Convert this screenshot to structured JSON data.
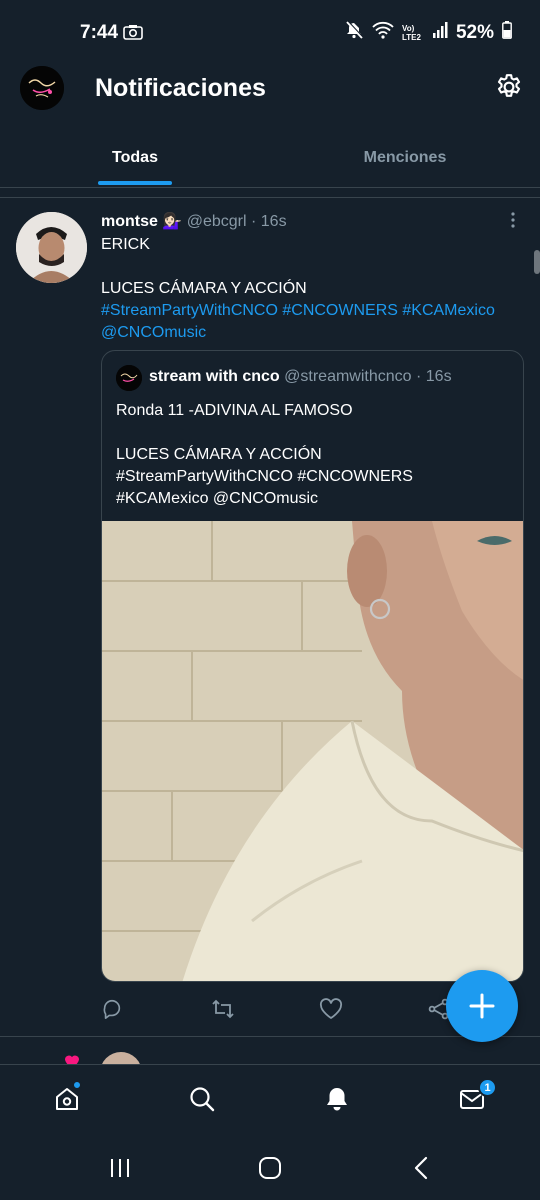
{
  "status_bar": {
    "time": "7:44",
    "network_label": "Vo) LTE2",
    "battery": "52%"
  },
  "header": {
    "title": "Notificaciones",
    "avatar_label": "Stream Party CNCO"
  },
  "tabs": [
    {
      "label": "Todas",
      "active": true
    },
    {
      "label": "Menciones",
      "active": false
    }
  ],
  "tweet": {
    "name": "montse 💁🏻‍♀️",
    "handle": "@ebcgrl",
    "separator": "·",
    "time": "16s",
    "text_lines": [
      {
        "text": "ERICK",
        "color": "white"
      },
      {
        "text": "",
        "color": "white"
      },
      {
        "text": "LUCES CÁMARA Y ACCIÓN",
        "color": "white"
      },
      {
        "text": "#StreamPartyWithCNCO  #CNCOWNERS #KCAMexico",
        "color": "blue"
      },
      {
        "text": "@CNCOmusic",
        "color": "blue"
      }
    ],
    "quote": {
      "name": "stream with cnco",
      "handle": "@streamwithcnco",
      "separator": "·",
      "time": "16s",
      "text_lines": [
        "Ronda 11 -ADIVINA AL FAMOSO",
        "",
        "LUCES CÁMARA Y ACCIÓN",
        "#StreamPartyWithCNCO  #CNCOWNERS",
        "#KCAMexico @CNCOmusic"
      ]
    }
  },
  "bottom_nav": {
    "messages_badge": "1"
  },
  "colors": {
    "background": "#15202b",
    "accent": "#1d9bf0",
    "muted": "#8899a6",
    "border": "#38444d"
  }
}
